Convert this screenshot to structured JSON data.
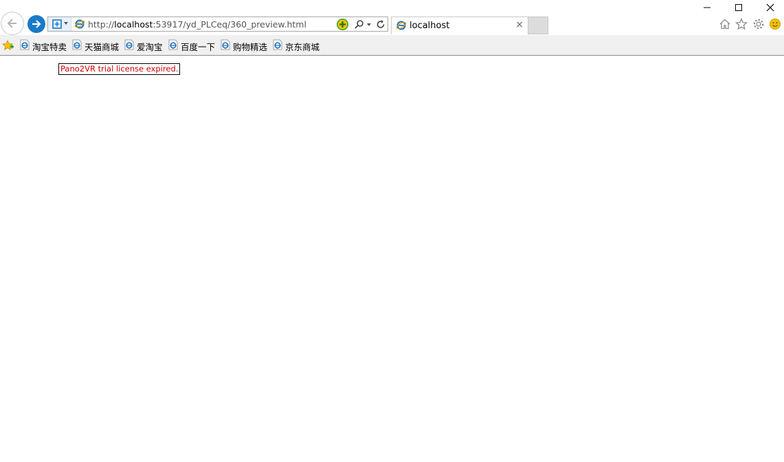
{
  "toolbar": {
    "url_scheme": "http://",
    "url_host": "localhost",
    "url_rest": ":53917/yd_PLCeq/360_preview.html"
  },
  "tab": {
    "label": "localhost",
    "close": "×"
  },
  "favorites": [
    {
      "label": "淘宝特卖"
    },
    {
      "label": "天猫商城"
    },
    {
      "label": "爱淘宝"
    },
    {
      "label": "百度一下"
    },
    {
      "label": "购物精选"
    },
    {
      "label": "京东商城"
    }
  ],
  "page": {
    "license_message": "Pano2VR trial license expired."
  },
  "colors": {
    "accent": "#1979ca",
    "message_text": "#d20000",
    "addon_green": "#3a9d23",
    "smiley": "#f2c200"
  },
  "icons": [
    "back-arrow-icon",
    "forward-arrow-icon",
    "compatibility-view-icon",
    "ie-page-icon",
    "addon-icon",
    "search-icon",
    "refresh-icon",
    "home-icon",
    "favorites-star-icon",
    "gear-icon",
    "smiley-icon",
    "favorites-bar-star-icon"
  ]
}
